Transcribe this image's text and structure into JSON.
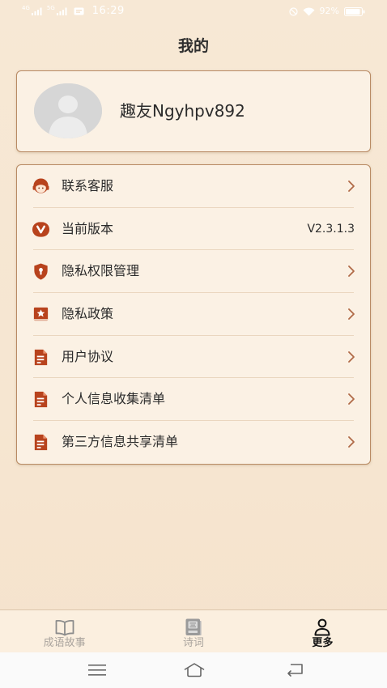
{
  "status_bar": {
    "net_left": "4G",
    "net_right": "5G",
    "time": "16:29",
    "battery": "92%",
    "battery_level": 0.92
  },
  "page": {
    "title": "我的"
  },
  "profile": {
    "username": "趣友Ngyhpv892",
    "avatar_icon": "default-avatar-icon"
  },
  "menu": {
    "items": [
      {
        "label": "联系客服",
        "icon": "customer-service-icon",
        "trailing_icon": "chevron-right-icon"
      },
      {
        "label": "当前版本",
        "icon": "version-icon",
        "value": "V2.3.1.3"
      },
      {
        "label": "隐私权限管理",
        "icon": "shield-icon",
        "trailing_icon": "chevron-right-icon"
      },
      {
        "label": "隐私政策",
        "icon": "star-bookmark-icon",
        "trailing_icon": "chevron-right-icon"
      },
      {
        "label": "用户协议",
        "icon": "document-icon",
        "trailing_icon": "chevron-right-icon"
      },
      {
        "label": "个人信息收集清单",
        "icon": "document-icon",
        "trailing_icon": "chevron-right-icon"
      },
      {
        "label": "第三方信息共享清单",
        "icon": "document-icon",
        "trailing_icon": "chevron-right-icon"
      }
    ]
  },
  "tab_bar": {
    "tabs": [
      {
        "label": "成语故事",
        "icon": "open-book-icon",
        "active": false
      },
      {
        "label": "诗词",
        "icon": "poetry-book-icon",
        "active": false
      },
      {
        "label": "更多",
        "icon": "user-icon",
        "active": true
      }
    ]
  },
  "system_nav": {
    "icons": [
      "menu-icon",
      "home-icon",
      "back-icon"
    ]
  },
  "colors": {
    "background": "#f6e6d1",
    "card": "#fbf1e4",
    "accent": "#b8431d",
    "chevron": "#b06a47",
    "text": "#2b2b2b",
    "tab_inactive": "#aaa49e",
    "tab_active": "#111111",
    "status_text": "#ffffff"
  }
}
